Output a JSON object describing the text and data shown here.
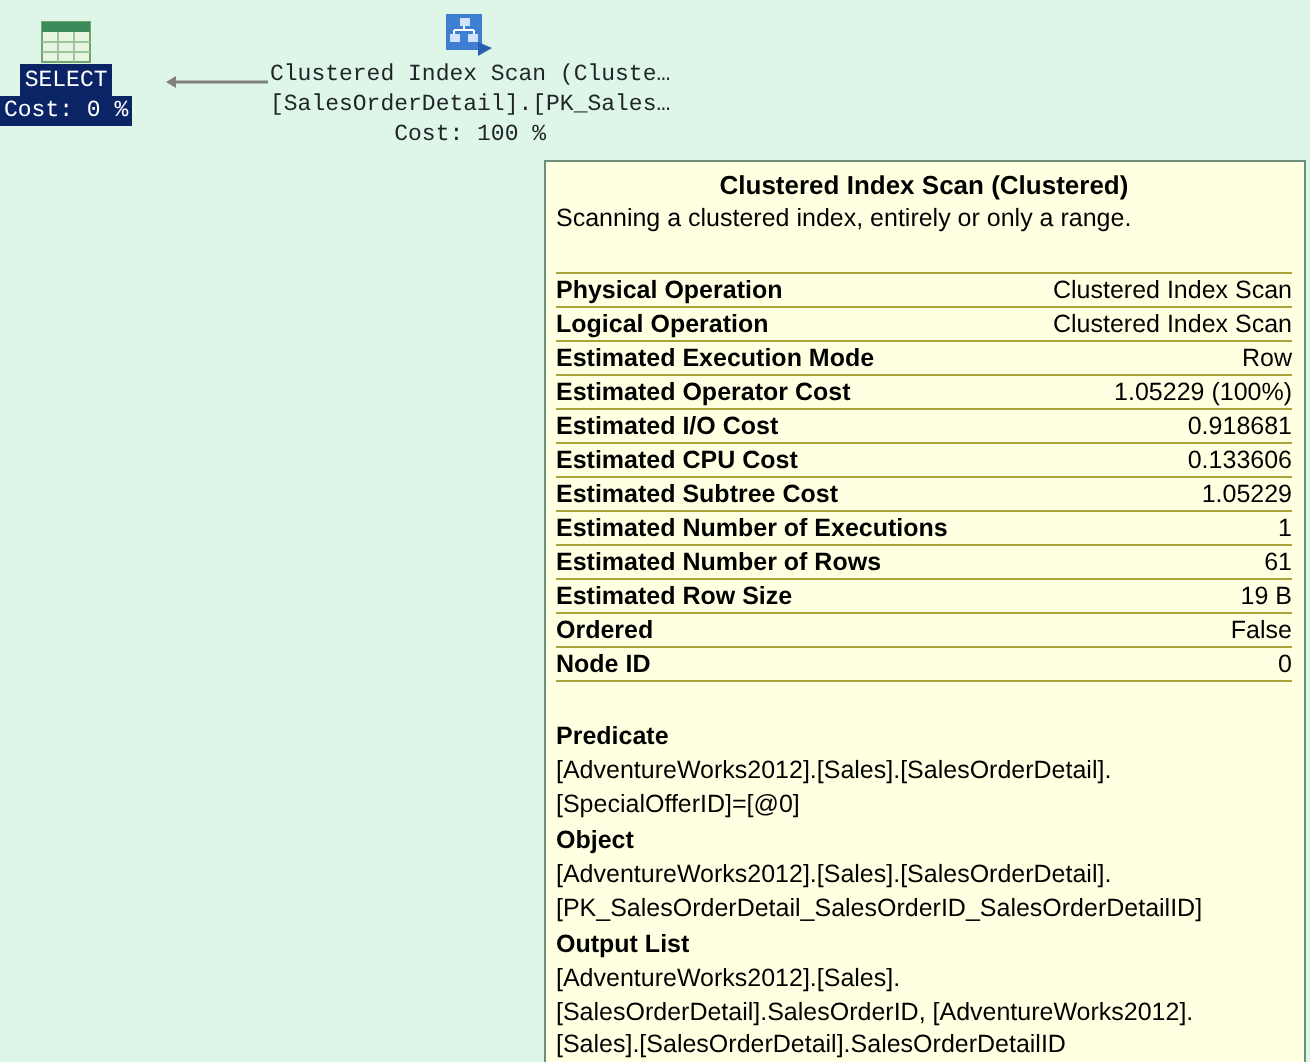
{
  "nodes": [
    {
      "kind": "select",
      "lines": [
        "SELECT",
        "Cost: 0 %"
      ],
      "selected": true
    },
    {
      "kind": "scan",
      "lines": [
        "Clustered Index Scan (Cluste…",
        "[SalesOrderDetail].[PK_Sales…",
        "Cost: 100 %"
      ],
      "selected": false
    }
  ],
  "tooltip": {
    "title": "Clustered Index Scan (Clustered)",
    "description": "Scanning a clustered index, entirely or only a range.",
    "properties": [
      {
        "label": "Physical Operation",
        "value": "Clustered Index Scan"
      },
      {
        "label": "Logical Operation",
        "value": "Clustered Index Scan"
      },
      {
        "label": "Estimated Execution Mode",
        "value": "Row"
      },
      {
        "label": "Estimated Operator Cost",
        "value": "1.05229 (100%)"
      },
      {
        "label": "Estimated I/O Cost",
        "value": "0.918681"
      },
      {
        "label": "Estimated CPU Cost",
        "value": "0.133606"
      },
      {
        "label": "Estimated Subtree Cost",
        "value": "1.05229"
      },
      {
        "label": "Estimated Number of Executions",
        "value": "1"
      },
      {
        "label": "Estimated Number of Rows",
        "value": "61"
      },
      {
        "label": "Estimated Row Size",
        "value": "19 B"
      },
      {
        "label": "Ordered",
        "value": "False"
      },
      {
        "label": "Node ID",
        "value": "0"
      }
    ],
    "sections": [
      {
        "heading": "Predicate",
        "lines": [
          "[AdventureWorks2012].[Sales].[SalesOrderDetail].",
          "[SpecialOfferID]=[@0]"
        ]
      },
      {
        "heading": "Object",
        "lines": [
          "[AdventureWorks2012].[Sales].[SalesOrderDetail].",
          "[PK_SalesOrderDetail_SalesOrderID_SalesOrderDetailID]"
        ]
      },
      {
        "heading": "Output List",
        "lines": [
          "[AdventureWorks2012].[Sales].",
          "[SalesOrderDetail].SalesOrderID, [AdventureWorks2012].",
          "[Sales].[SalesOrderDetail].SalesOrderDetailID"
        ]
      }
    ]
  }
}
